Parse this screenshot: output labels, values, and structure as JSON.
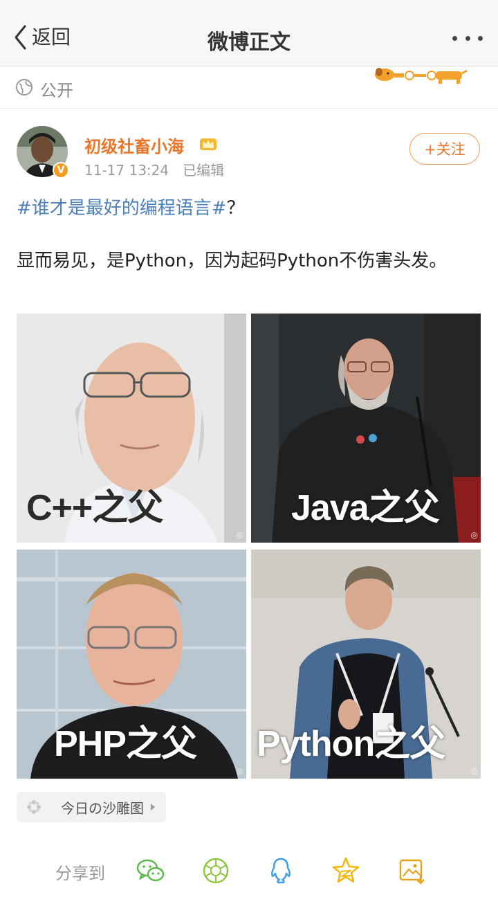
{
  "nav": {
    "back_label": "返回",
    "title": "微博正文"
  },
  "visibility": {
    "label": "公开"
  },
  "post": {
    "author": "初级社畜小海",
    "time": "11-17 13:24",
    "edited": "已编辑",
    "follow_label": "+关注",
    "hashtag": "#谁才是最好的编程语言#",
    "hashtag_suffix": "？",
    "content": "显而易见，是Python，因为起码Python不伤害头发。",
    "images": [
      {
        "caption": "C++之父"
      },
      {
        "caption": "Java之父"
      },
      {
        "caption": "PHP之父"
      },
      {
        "caption": "Python之父"
      }
    ]
  },
  "topic": {
    "label": "今日の沙雕图"
  },
  "share": {
    "label": "分享到",
    "icons": [
      "wechat-icon",
      "moments-icon",
      "qq-icon",
      "qzone-icon",
      "save-image-icon"
    ]
  },
  "colors": {
    "accent": "#e8762b",
    "link": "#4d7fba",
    "share_green": "#58b947",
    "share_blue": "#3a9ee6",
    "share_yellow": "#f5b400"
  }
}
